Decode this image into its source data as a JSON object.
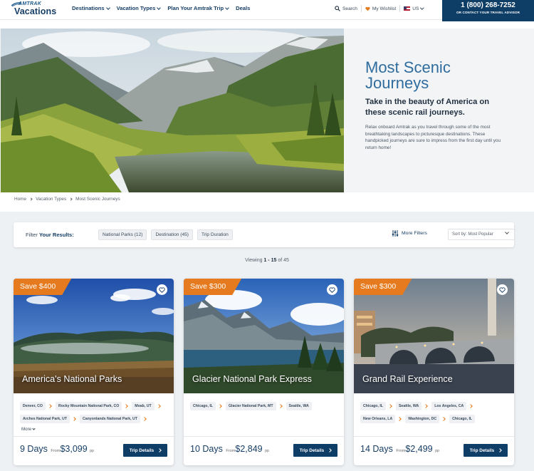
{
  "header": {
    "logo_top": "AMTRAK",
    "logo_main": "Vacations",
    "nav": [
      {
        "label": "Destinations"
      },
      {
        "label": "Vacation Types"
      },
      {
        "label": "Plan Your Amtrak Trip"
      },
      {
        "label": "Deals"
      }
    ],
    "search_label": "Search",
    "wishlist_label": "My Wishlist",
    "locale_label": "US",
    "phone": "1 (800) 268-7252",
    "phone_sub": "OR CONTACT YOUR TRAVEL ADVISOR"
  },
  "hero": {
    "title": "Most Scenic Journeys",
    "subtitle": "Take in the beauty of America on these scenic rail journeys.",
    "description": "Relax onboard Amtrak as you travel through some of the most breathtaking landscapes to picturesque destinations. These handpicked journeys are sure to impress from the first day until you return home!"
  },
  "breadcrumb": [
    "Home",
    "Vacation Types",
    "Most Scenic Journeys"
  ],
  "filter": {
    "label_prefix": "Filter",
    "label_bold": "Your Results:",
    "chips": [
      "National Parks (12)",
      "Destination (45)",
      "Trip Duration"
    ],
    "more_filters": "More Filters",
    "sort": "Sort by: Most Popular"
  },
  "viewing": {
    "prefix": "Viewing",
    "range": "1 - 15",
    "suffix": "of 45"
  },
  "cards": [
    {
      "save": "Save $400",
      "title": "America's National Parks",
      "stops": [
        "Denver, CO",
        "Rocky Mountain National Park, CO",
        "Moab, UT",
        "Arches National Park, UT",
        "Canyonlands National Park, UT"
      ],
      "more": "More",
      "days": "9 Days",
      "from": "From",
      "price": "$3,099",
      "pp": "pp",
      "button": "Trip Details"
    },
    {
      "save": "Save $300",
      "title": "Glacier National Park Express",
      "stops": [
        "Chicago, IL",
        "Glacier National Park, MT",
        "Seattle, WA"
      ],
      "more": "",
      "days": "10 Days",
      "from": "From",
      "price": "$2,849",
      "pp": "pp",
      "button": "Trip Details"
    },
    {
      "save": "Save $300",
      "title": "Grand Rail Experience",
      "stops": [
        "Chicago, IL",
        "Seattle, WA",
        "Los Angeles, CA",
        "New Orleans, LA",
        "Washington, DC",
        "Chicago, IL"
      ],
      "more": "",
      "days": "14 Days",
      "from": "From",
      "price": "$2,499",
      "pp": "pp",
      "button": "Trip Details"
    }
  ],
  "colors": {
    "navy": "#0e3d66",
    "accent_orange": "#e57a1f",
    "title_blue": "#2f6d9e"
  },
  "icons": [
    "search-icon",
    "heart-icon",
    "us-flag-icon",
    "filter-sliders-icon",
    "chevron-down-icon"
  ]
}
